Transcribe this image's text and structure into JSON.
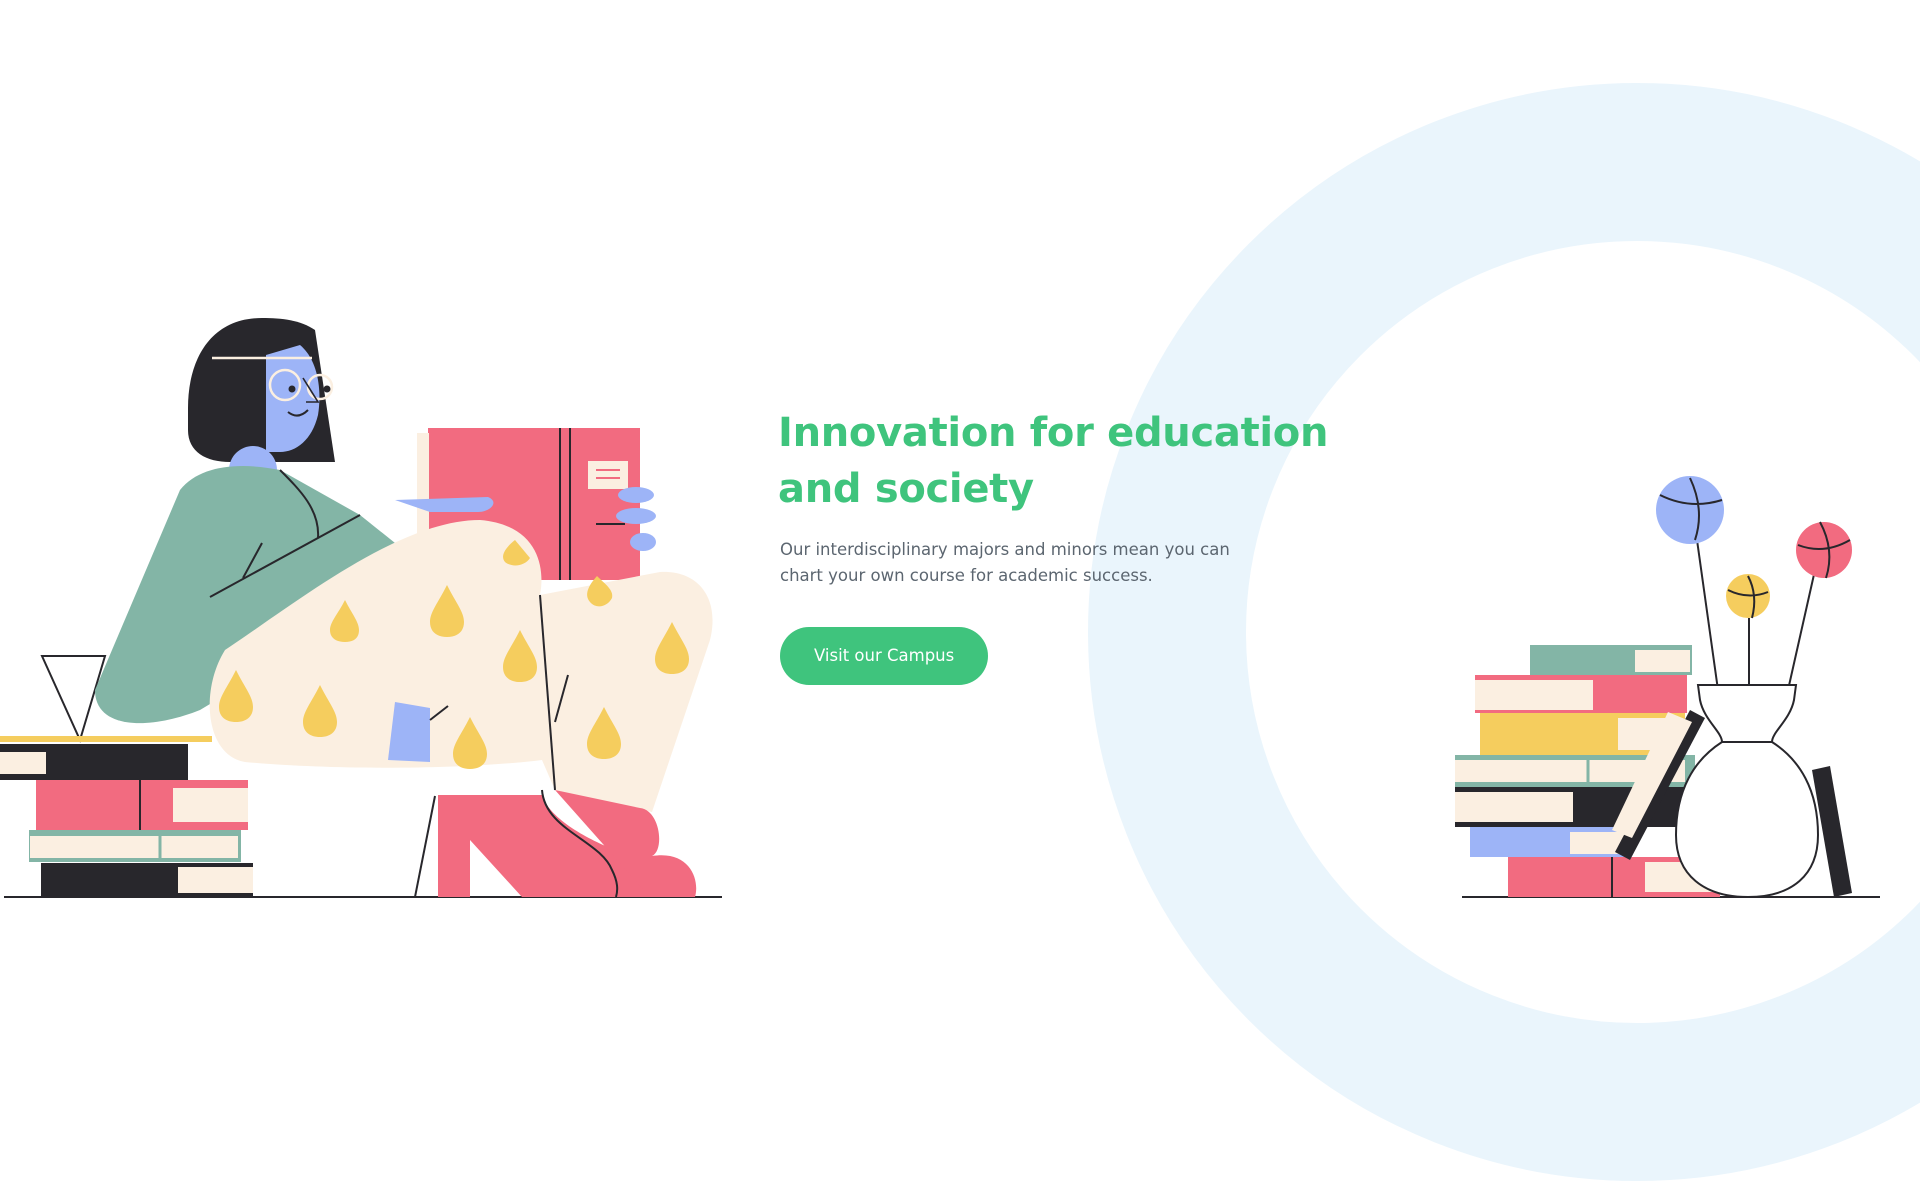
{
  "hero": {
    "title_line1": "Innovation for education",
    "title_line2": "and society",
    "subtitle_line1": "Our interdisciplinary majors and minors mean you can",
    "subtitle_line2": "chart your own course for academic success.",
    "cta_label": "Visit our Campus"
  },
  "colors": {
    "accent_green": "#3fc47d",
    "ring_blue": "#eaf5fc",
    "book_pink": "#f26b80",
    "skin_blue": "#9db4f7",
    "sweater_green": "#83b5a6",
    "cream": "#fbefe1",
    "yellow": "#f5cd5e",
    "ink": "#28272c"
  },
  "illustrations": {
    "left": "woman-reading-book-illustration",
    "right": "book-stack-with-flower-vase-illustration"
  }
}
